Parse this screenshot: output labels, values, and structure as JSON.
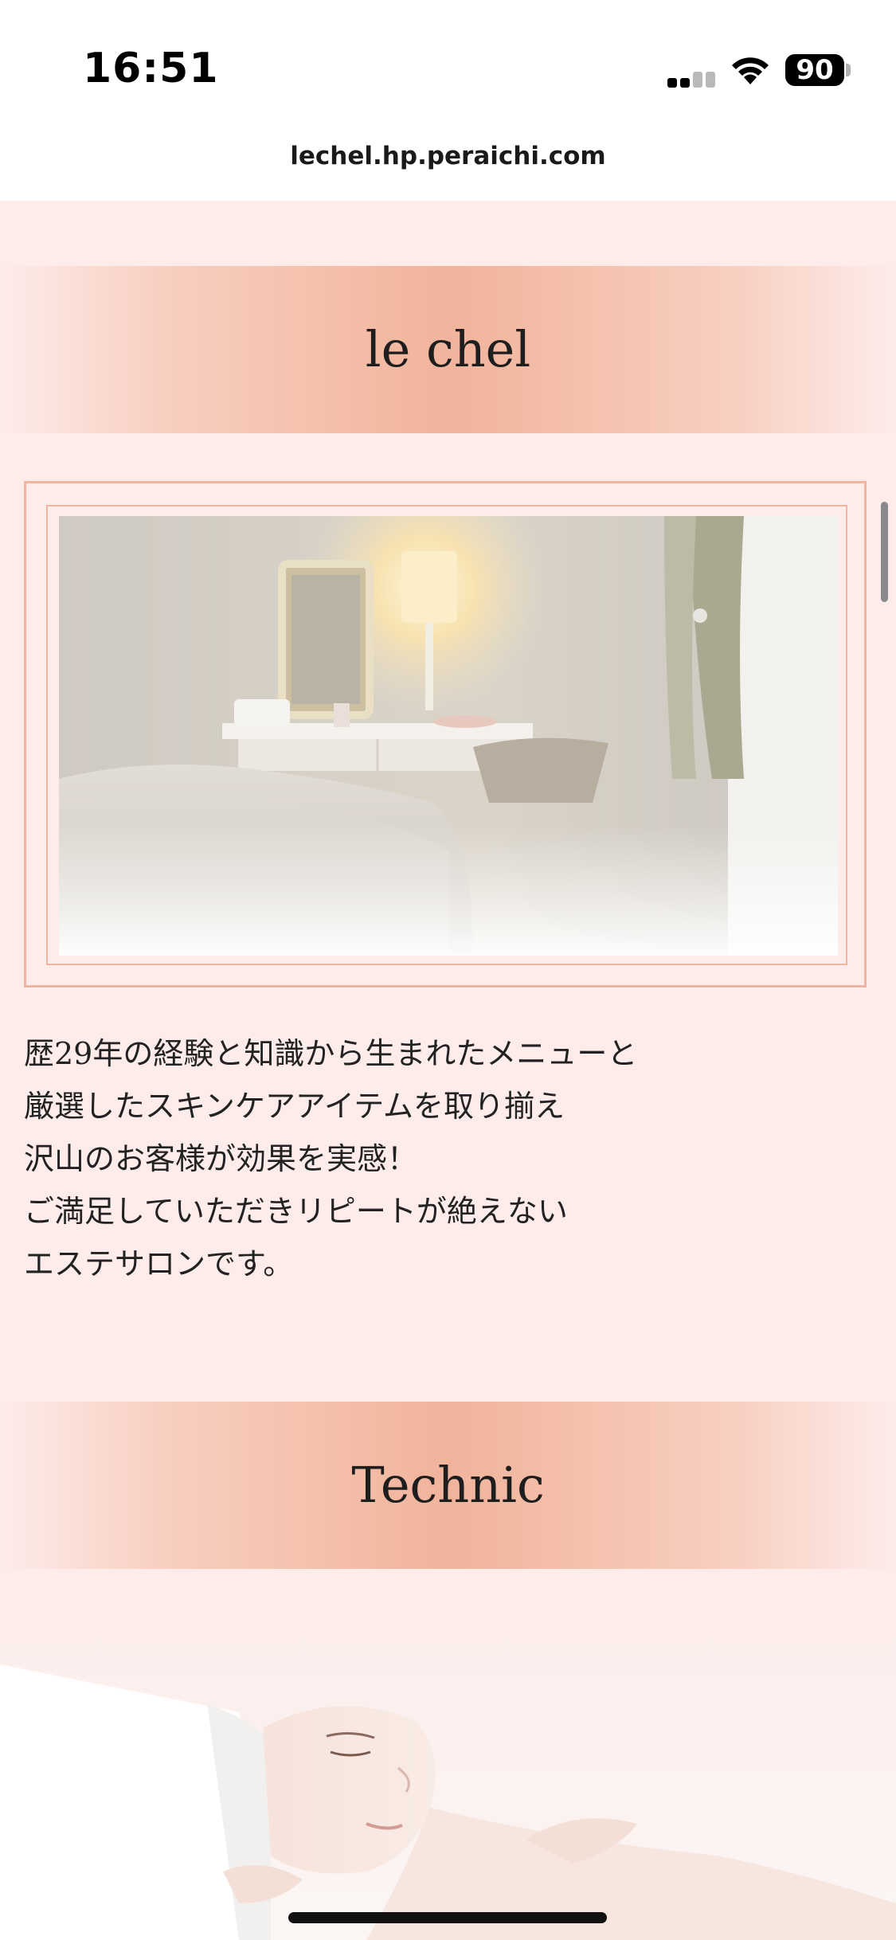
{
  "status_bar": {
    "time": "16:51",
    "battery": "90",
    "icons": [
      "signal-icon",
      "wifi-icon",
      "battery-icon"
    ]
  },
  "browser": {
    "url": "lechel.hp.peraichi.com"
  },
  "sections": {
    "intro": {
      "title": "le chel",
      "image": "salon-room-photo",
      "description_lines": [
        "歴29年の経験と知識から生まれたメニューと",
        "厳選したスキンケアアイテムを取り揃え",
        "沢山のお客様が効果を実感！",
        "ご満足していただきリピートが絶えない",
        "エステサロンです。"
      ]
    },
    "technic": {
      "title": "Technic",
      "image": "facial-treatment-photo"
    }
  },
  "colors": {
    "page_background": "#fdecea",
    "band_accent": "#f1b39b",
    "frame_border": "#f0b5a1"
  }
}
